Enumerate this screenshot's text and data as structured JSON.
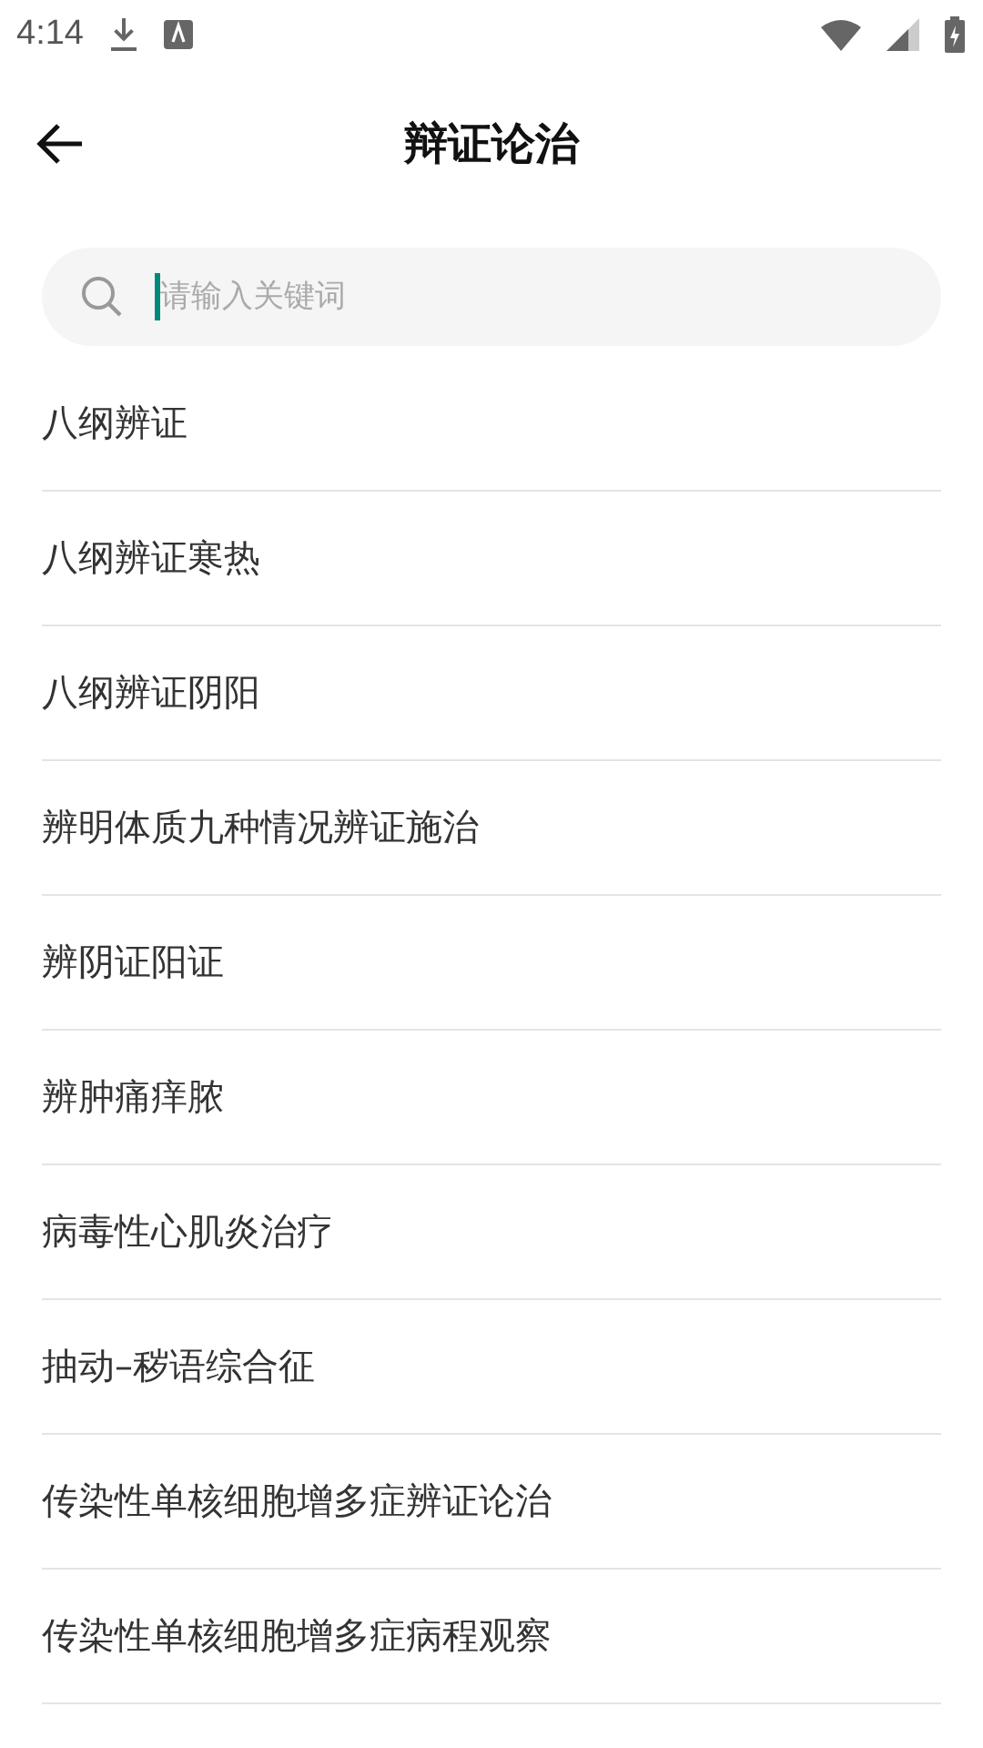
{
  "status_bar": {
    "time": "4:14"
  },
  "header": {
    "title": "辩证论治"
  },
  "search": {
    "placeholder": "请输入关键词"
  },
  "items": [
    "八纲辨证",
    "八纲辨证寒热",
    "八纲辨证阴阳",
    "辨明体质九种情况辨证施治",
    "辨阴证阳证",
    "辨肿痛痒脓",
    "病毒性心肌炎治疗",
    "抽动–秽语综合征",
    "传染性单核细胞增多症辨证论治",
    "传染性单核细胞增多症病程观察"
  ]
}
